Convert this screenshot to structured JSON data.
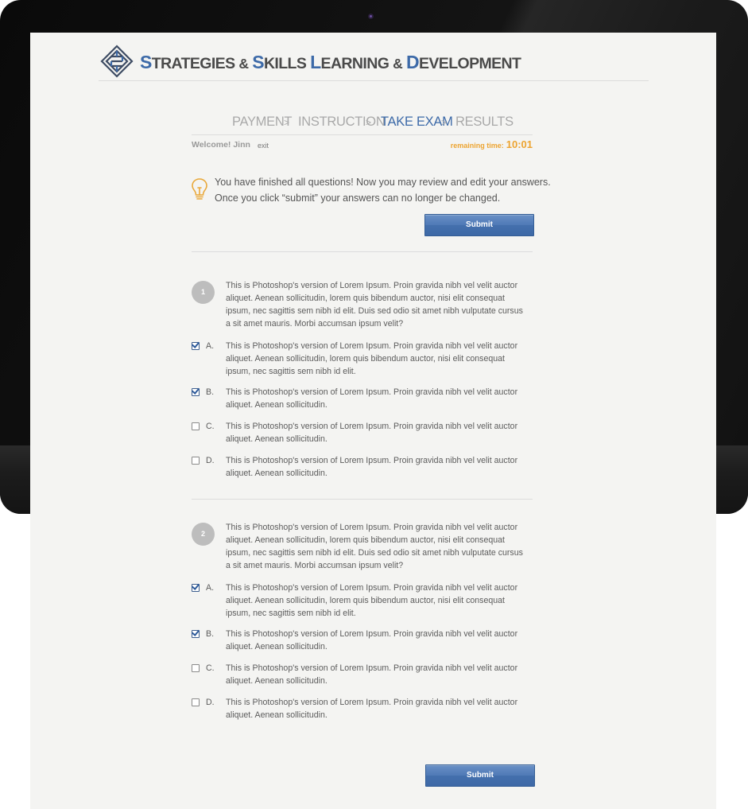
{
  "brand": {
    "title_parts": [
      "S",
      "TRATEGIES ",
      "&",
      " ",
      "S",
      "KILLS ",
      "L",
      "EARNING ",
      "&",
      " ",
      "D",
      "EVELOPMENT"
    ]
  },
  "steps": [
    {
      "label": "PAYMENT"
    },
    {
      "label": "INSTRUCTION"
    },
    {
      "label": "TAKE EXAM"
    },
    {
      "label": "RESULTS"
    }
  ],
  "step_separator": ">",
  "user": {
    "welcome": "Welcome! Jinn",
    "exit_label": "exit"
  },
  "timer": {
    "label": "remaining time:",
    "value": "10:01"
  },
  "notice": {
    "line1": "You have finished all questions! Now you may review and edit your answers.",
    "line2": "Once you click “submit” your answers can no longer be changed."
  },
  "submit_label": "Submit",
  "questions": [
    {
      "number": "1",
      "text": [
        "This is Photoshop's version  of Lorem Ipsum. Proin gravida nibh vel velit auctor",
        "aliquet. Aenean sollicitudin, lorem quis bibendum auctor, nisi elit consequat",
        "ipsum, nec sagittis sem nibh id elit. Duis sed odio sit amet nibh vulputate cursus",
        "a sit amet mauris. Morbi accumsan ipsum velit?"
      ],
      "options": [
        {
          "letter": "A.",
          "checked": true,
          "text": [
            "This is Photoshop's version  of Lorem Ipsum. Proin gravida nibh vel velit auctor",
            "aliquet. Aenean sollicitudin, lorem quis bibendum auctor, nisi elit consequat",
            "ipsum, nec sagittis sem nibh id elit."
          ]
        },
        {
          "letter": "B.",
          "checked": true,
          "text": [
            "This is Photoshop's version  of Lorem Ipsum. Proin gravida nibh vel velit auctor",
            "aliquet. Aenean sollicitudin."
          ]
        },
        {
          "letter": "C.",
          "checked": false,
          "text": [
            "This is Photoshop's version  of Lorem Ipsum. Proin gravida nibh vel velit auctor",
            "aliquet. Aenean sollicitudin."
          ]
        },
        {
          "letter": "D.",
          "checked": false,
          "text": [
            "This is Photoshop's version  of Lorem Ipsum. Proin gravida nibh vel velit auctor",
            "aliquet. Aenean sollicitudin."
          ]
        }
      ]
    },
    {
      "number": "2",
      "text": [
        "This is Photoshop's version  of Lorem Ipsum. Proin gravida nibh vel velit auctor",
        "aliquet. Aenean sollicitudin, lorem quis bibendum auctor, nisi elit consequat",
        "ipsum, nec sagittis sem nibh id elit. Duis sed odio sit amet nibh vulputate cursus",
        "a sit amet mauris. Morbi accumsan ipsum velit?"
      ],
      "options": [
        {
          "letter": "A.",
          "checked": true,
          "text": [
            "This is Photoshop's version  of Lorem Ipsum. Proin gravida nibh vel velit auctor",
            "aliquet. Aenean sollicitudin, lorem quis bibendum auctor, nisi elit consequat",
            "ipsum, nec sagittis sem nibh id elit."
          ]
        },
        {
          "letter": "B.",
          "checked": true,
          "text": [
            "This is Photoshop's version  of Lorem Ipsum. Proin gravida nibh vel velit auctor",
            "aliquet. Aenean sollicitudin."
          ]
        },
        {
          "letter": "C.",
          "checked": false,
          "text": [
            "This is Photoshop's version  of Lorem Ipsum. Proin gravida nibh vel velit auctor",
            "aliquet. Aenean sollicitudin."
          ]
        },
        {
          "letter": "D.",
          "checked": false,
          "text": [
            "This is Photoshop's version  of Lorem Ipsum. Proin gravida nibh vel velit auctor",
            "aliquet. Aenean sollicitudin."
          ]
        }
      ]
    }
  ],
  "colors": {
    "accent": "#3d6aa8",
    "timer": "#eda431",
    "button": "#4a75b3"
  },
  "icons": {
    "logo": "maze-logo-icon",
    "notice": "lightbulb-icon",
    "checkbox": "checkbox-icon"
  }
}
